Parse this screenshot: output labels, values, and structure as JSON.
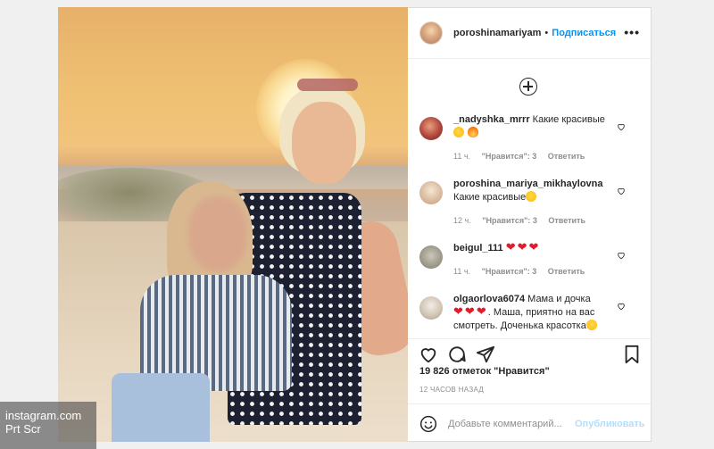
{
  "watermark": {
    "line1": "instagram.com",
    "line2": "Prt Scr"
  },
  "header": {
    "username": "poroshinamariyam",
    "dot": "•",
    "follow_label": "Подписаться",
    "more_icon": "ellipsis-icon"
  },
  "load_more_icon": "plus-circle-icon",
  "comments": [
    {
      "user": "_nadyshka_mrrr",
      "text": "Какие красивые",
      "emojis": [
        "star-struck",
        "fire"
      ],
      "age": "11 ч.",
      "likes": "\"Нравится\": 3",
      "reply": "Ответить"
    },
    {
      "user": "poroshina_mariya_mikhaylovna",
      "text": "Какие красивые",
      "emojis": [
        "star-struck"
      ],
      "age": "12 ч.",
      "likes": "\"Нравится\": 3",
      "reply": "Ответить"
    },
    {
      "user": "beigul_111",
      "text": "",
      "emojis": [
        "heart",
        "heart",
        "heart"
      ],
      "age": "11 ч.",
      "likes": "\"Нравится\": 3",
      "reply": "Ответить"
    },
    {
      "user": "olgaorlova6074",
      "text": "Мама и дочка",
      "text2": ". Маша, приятно на вас смотреть. Доченька красотка",
      "emojis": [
        "heart",
        "heart",
        "heart"
      ],
      "age": "",
      "likes": "",
      "reply": ""
    }
  ],
  "likes_summary": "19 826 отметок \"Нравится\"",
  "posted_ago": "12 ЧАСОВ НАЗАД",
  "composer": {
    "placeholder": "Добавьте комментарий...",
    "publish_label": "Опубликовать"
  },
  "colors": {
    "link": "#0095f6",
    "publish_disabled": "#b2dffc",
    "heart": "#e01b2c",
    "border": "#dbdbdb",
    "meta_text": "#8e8e8e"
  }
}
